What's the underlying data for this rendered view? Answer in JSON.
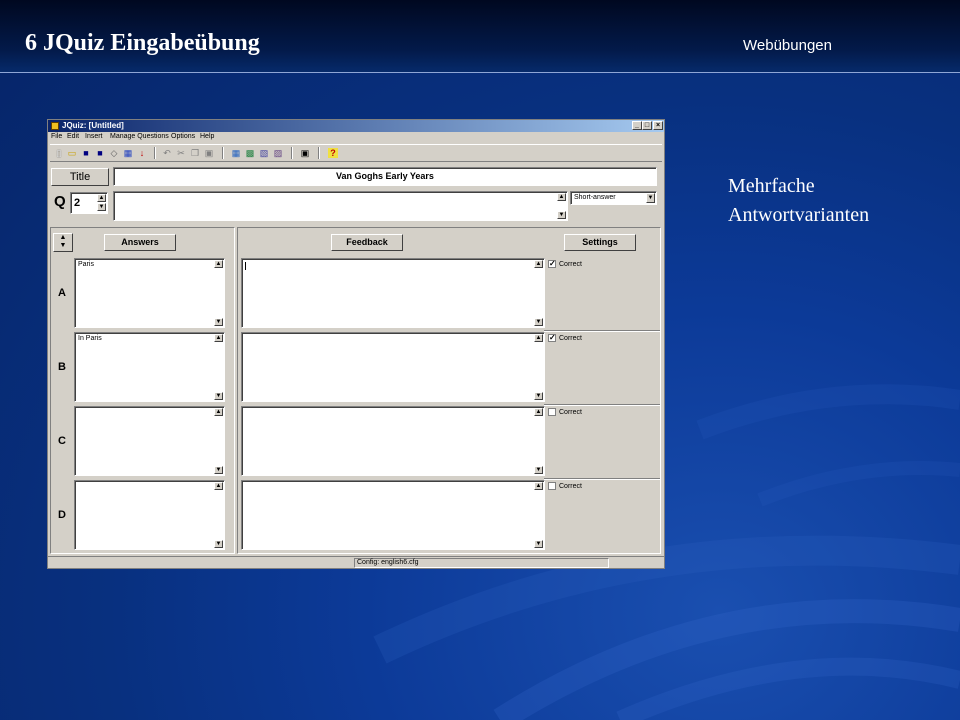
{
  "slide": {
    "title": "6 JQuiz Eingabeübung",
    "section": "Webübungen",
    "note": "Mehrfache Antwortvarianten"
  },
  "window": {
    "title": "JQuiz: [Untitled]",
    "controls": [
      "_",
      "□",
      "×"
    ],
    "menu": [
      "File",
      "Edit",
      "Insert",
      "Manage Questions",
      "Options",
      "Help"
    ],
    "toolbar_icons": [
      "new-icon",
      "open-icon",
      "save-icon",
      "save-as-icon",
      "eraser-icon",
      "web-icon",
      "export-icon",
      "undo-icon",
      "cut-icon",
      "copy-icon",
      "paste-icon",
      "tool1-icon",
      "tool2-icon",
      "tool3-icon",
      "tool4-icon",
      "monitor-icon",
      "help-icon"
    ]
  },
  "quiz": {
    "title_label": "Title",
    "title_value": "Van Goghs Early Years",
    "q_label": "Q",
    "question_number": "2",
    "question_text": "",
    "question_type": "Short-answer"
  },
  "columns": {
    "answers": "Answers",
    "feedback": "Feedback",
    "settings": "Settings"
  },
  "rows": [
    {
      "label": "A",
      "answer": "Paris",
      "feedback": "",
      "correct": true,
      "correct_label": "Correct"
    },
    {
      "label": "B",
      "answer": "In Paris",
      "feedback": "",
      "correct": true,
      "correct_label": "Correct"
    },
    {
      "label": "C",
      "answer": "",
      "feedback": "",
      "correct": false,
      "correct_label": "Correct"
    },
    {
      "label": "D",
      "answer": "",
      "feedback": "",
      "correct": false,
      "correct_label": "Correct"
    }
  ],
  "status": "Config: english6.cfg",
  "colors": {
    "slide_bg": "#08307f",
    "titlebar": "#0a246a",
    "window_face": "#d4d0c8"
  }
}
